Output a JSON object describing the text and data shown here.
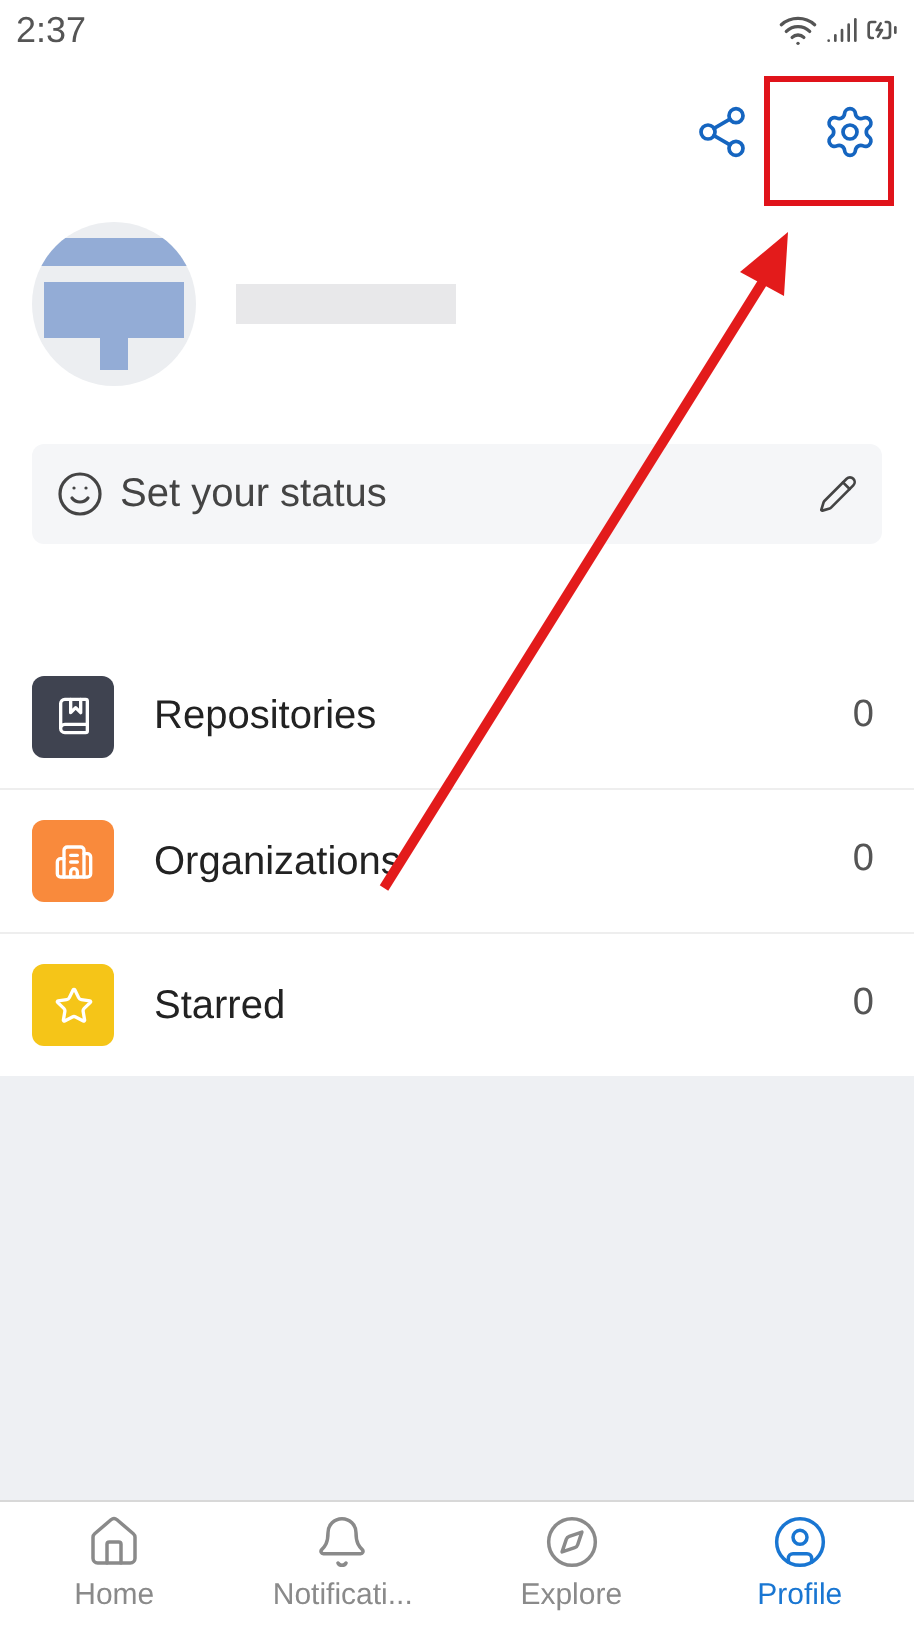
{
  "status_bar": {
    "time": "2:37"
  },
  "status": {
    "placeholder": "Set your status"
  },
  "menu": [
    {
      "label": "Repositories",
      "count": "0",
      "color": "#3f4350",
      "kind": "repo"
    },
    {
      "label": "Organizations",
      "count": "0",
      "color": "#f98a3c",
      "kind": "org"
    },
    {
      "label": "Starred",
      "count": "0",
      "color": "#f5c518",
      "kind": "star"
    }
  ],
  "tabs": [
    {
      "label": "Home",
      "kind": "home",
      "selected": false
    },
    {
      "label": "Notificati...",
      "kind": "bell",
      "selected": false
    },
    {
      "label": "Explore",
      "kind": "explore",
      "selected": false
    },
    {
      "label": "Profile",
      "kind": "profile",
      "selected": true
    }
  ]
}
